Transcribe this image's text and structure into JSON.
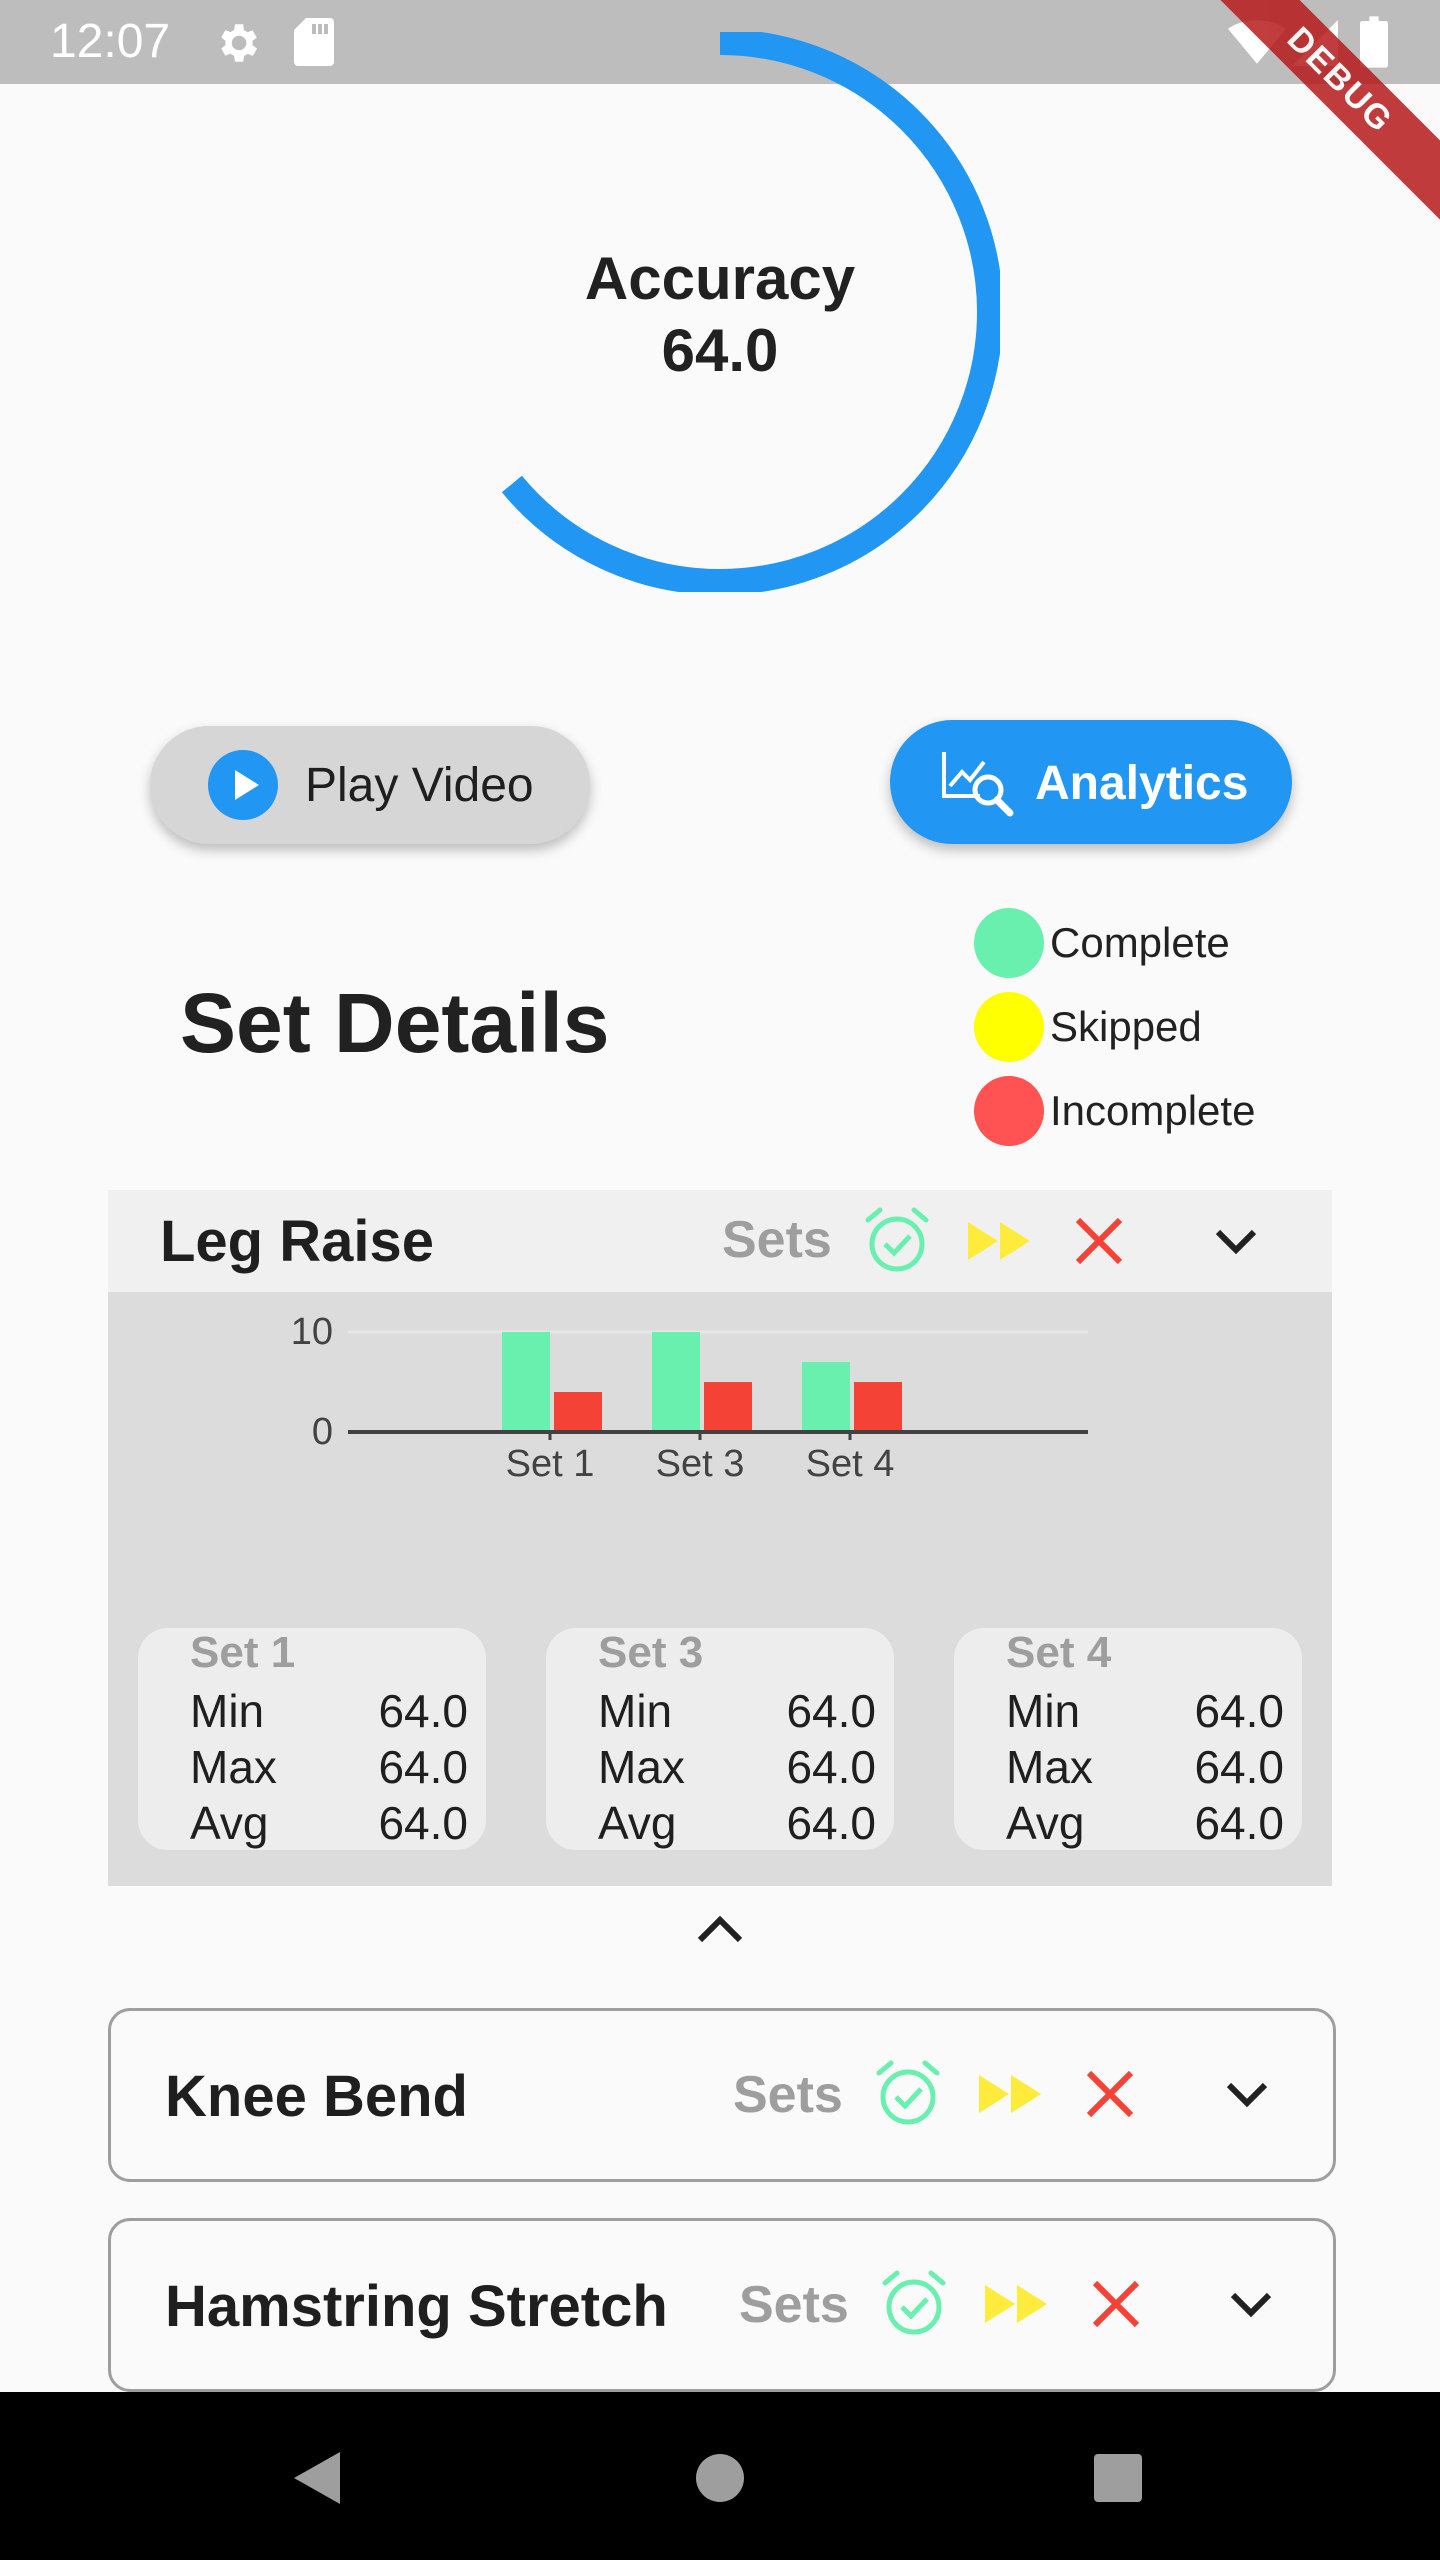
{
  "status_bar": {
    "time": "12:07",
    "debug_banner": "DEBUG"
  },
  "accuracy": {
    "label": "Accuracy",
    "value": "64.0",
    "fraction": 0.64,
    "color": "#2196f3"
  },
  "buttons": {
    "play_video": "Play Video",
    "analytics": "Analytics"
  },
  "set_details": {
    "title": "Set Details"
  },
  "legend": [
    {
      "label": "Complete",
      "color": "#69f0ae"
    },
    {
      "label": "Skipped",
      "color": "#ffff00"
    },
    {
      "label": "Incomplete",
      "color": "#ff5252"
    }
  ],
  "exercises": [
    {
      "name": "Leg Raise",
      "sets_label": "Sets",
      "expanded": true,
      "chart_data": {
        "type": "bar",
        "categories": [
          "Set 1",
          "Set 3",
          "Set 4"
        ],
        "series": [
          {
            "values": [
              10,
              10,
              7
            ],
            "color": "#69f0ae"
          },
          {
            "values": [
              4,
              5,
              5
            ],
            "color": "#f44336"
          }
        ],
        "ylim": [
          0,
          10
        ],
        "yticks": [
          "0",
          "10"
        ],
        "xlabel": "",
        "ylabel": ""
      },
      "stats": [
        {
          "set": "Set 1",
          "rows": [
            [
              "Min",
              "64.0"
            ],
            [
              "Max",
              "64.0"
            ],
            [
              "Avg",
              "64.0"
            ]
          ]
        },
        {
          "set": "Set 3",
          "rows": [
            [
              "Min",
              "64.0"
            ],
            [
              "Max",
              "64.0"
            ],
            [
              "Avg",
              "64.0"
            ]
          ]
        },
        {
          "set": "Set 4",
          "rows": [
            [
              "Min",
              "64.0"
            ],
            [
              "Max",
              "64.0"
            ],
            [
              "Avg",
              "64.0"
            ]
          ]
        }
      ]
    },
    {
      "name": "Knee Bend",
      "sets_label": "Sets",
      "expanded": false
    },
    {
      "name": "Hamstring Stretch",
      "sets_label": "Sets",
      "expanded": false
    }
  ],
  "icons": {
    "status": [
      "gear-icon",
      "sd-card-icon",
      "wifi-icon",
      "signal-icon",
      "battery-icon"
    ],
    "set_status": [
      "alarm-check-icon",
      "fast-forward-icon",
      "close-icon"
    ],
    "nav": [
      "back-icon",
      "home-icon",
      "recents-icon"
    ]
  }
}
